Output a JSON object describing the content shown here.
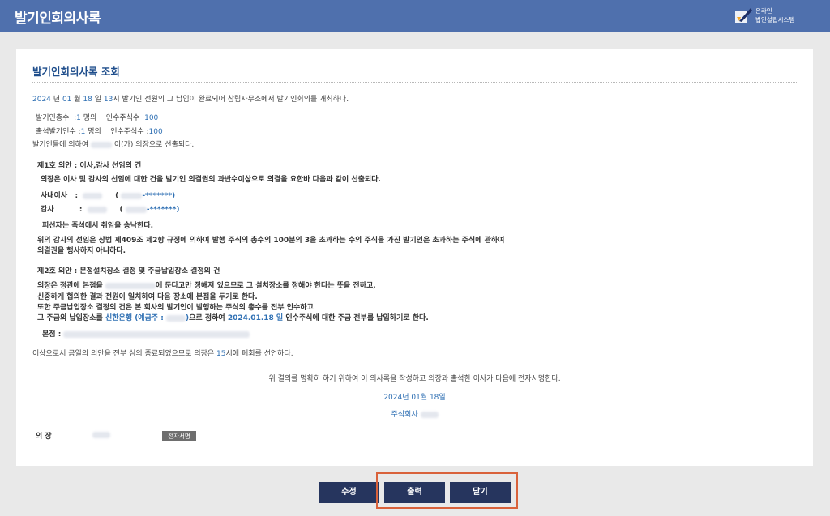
{
  "header": {
    "title": "발기인회의사록",
    "brand_line1": "온라인",
    "brand_line2": "법인설립시스템"
  },
  "card_title": "발기인회의사록 조회",
  "intro": {
    "year": "2024",
    "y": "년",
    "month": "01",
    "m": "월",
    "day": "18",
    "d": "일",
    "hour": "13",
    "rest": "시 발기인 전원의 그 납입이 완료되어 창립사무소에서 발기인회의를 개최하다."
  },
  "counts": {
    "total_label": "발기인총수",
    "total_val": "1",
    "unit_person": "명의",
    "shares_label": "인수주식수 :",
    "shares_val": "100",
    "attend_label": "출석발기인수",
    "attend_val": "1",
    "attend_shares_val": "100",
    "chair_pre": "발기인들에 의하여",
    "chair_post": "이(가) 의장으로 선출되다."
  },
  "agenda1": {
    "title": "제1호 의안 : 이사,감사 선임의 건",
    "desc": "의장은 이사 및 감사의 선임에 대한 건을 발기인 의결권의 과반수이상으로 의결을 요한바 다음과 같이 선출되다.",
    "director_label": "사내이사",
    "auditor_label": "감사",
    "masked": "-*******)",
    "paren": "(",
    "colon": ":",
    "accept": "피선자는 즉석에서 취임을 승낙한다.",
    "note1": "위의 감사의 선임은 상법 제409조 제2항 규정에 의하여 발행 주식의 총수의 100분의 3을 초과하는 수의 주식을 가진 발기인은 초과하는 주식에 관하여",
    "note2": "의결권을 행사하지 아니하다."
  },
  "agenda2": {
    "title": "제2호 의안 : 본점설치장소 결정 및 주금납입장소 결정의 건",
    "l1a": "의장은 정관에 본점을",
    "l1b": "에 둔다고만 정해져 있으므로 그 설치장소를 정해야 한다는 뜻을 전하고,",
    "l2": "신중하게 협의한 결과 전원이 일치하여 다음 장소에 본점을 두기로 한다.",
    "l3": "또한 주금납입장소 결정의 건은 본 회사의 발기인이 발행하는 주식의 총수를 전부 인수하고",
    "l4a": "그 주금의 납입장소를",
    "bank": "신한은행 (예금주 :",
    "bank_close": ")",
    "l4b": "으로 정하여",
    "pay_date": "2024.01.18 일",
    "l4c": "인수주식에 대한 주금 전부를 납입하기로 한다.",
    "hq_label": "본점 :"
  },
  "closing": {
    "pre": "이상으로서 금일의 의안을 전부 심의 종료되었으므로 의장은",
    "hour": "15",
    "post": "시에 폐회를 선언하다."
  },
  "sign": {
    "statement": "위 결의를 명확히 하기 위하여 이 의사록을 작성하고 의장과 출석한 이사가 다음에 전자서명한다.",
    "date": "2024년 01월 18일",
    "company_prefix": "주식회사",
    "chair_label": "의 장",
    "sign_button": "전자서명"
  },
  "buttons": {
    "edit": "수정",
    "print": "출력",
    "close": "닫기"
  },
  "colors": {
    "header_bg": "#4f70ad",
    "accent_blue": "#2e6fb3",
    "button_bg": "#26355e",
    "highlight": "#d9623b"
  }
}
